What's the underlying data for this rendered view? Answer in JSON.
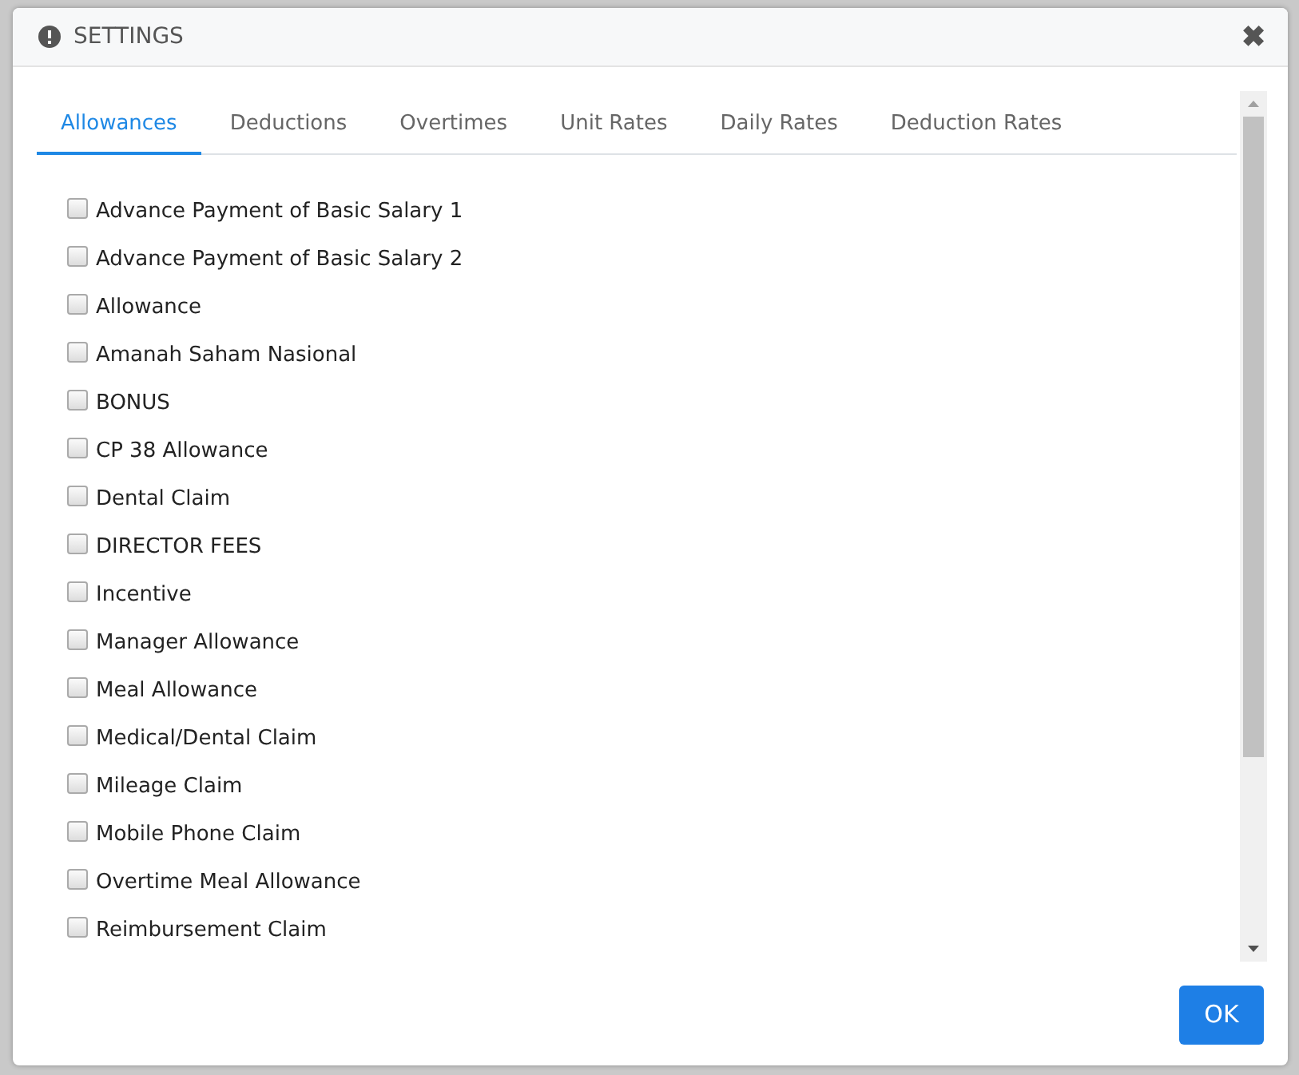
{
  "dialog": {
    "title": "SETTINGS",
    "close": "✖"
  },
  "tabs": [
    {
      "label": "Allowances",
      "selected": true
    },
    {
      "label": "Deductions",
      "selected": false
    },
    {
      "label": "Overtimes",
      "selected": false
    },
    {
      "label": "Unit Rates",
      "selected": false
    },
    {
      "label": "Daily Rates",
      "selected": false
    },
    {
      "label": "Deduction Rates",
      "selected": false
    }
  ],
  "items": [
    {
      "label": "Advance Payment of Basic Salary 1",
      "checked": false
    },
    {
      "label": "Advance Payment of Basic Salary 2",
      "checked": false
    },
    {
      "label": "Allowance",
      "checked": false
    },
    {
      "label": "Amanah Saham Nasional",
      "checked": false
    },
    {
      "label": "BONUS",
      "checked": false
    },
    {
      "label": "CP 38 Allowance",
      "checked": false
    },
    {
      "label": "Dental Claim",
      "checked": false
    },
    {
      "label": "DIRECTOR FEES",
      "checked": false
    },
    {
      "label": "Incentive",
      "checked": false
    },
    {
      "label": "Manager Allowance",
      "checked": false
    },
    {
      "label": "Meal Allowance",
      "checked": false
    },
    {
      "label": "Medical/Dental Claim",
      "checked": false
    },
    {
      "label": "Mileage Claim",
      "checked": false
    },
    {
      "label": "Mobile Phone Claim",
      "checked": false
    },
    {
      "label": "Overtime Meal Allowance",
      "checked": false
    },
    {
      "label": "Reimbursement Claim",
      "checked": false
    }
  ],
  "buttons": [
    {
      "label": "OK"
    }
  ]
}
